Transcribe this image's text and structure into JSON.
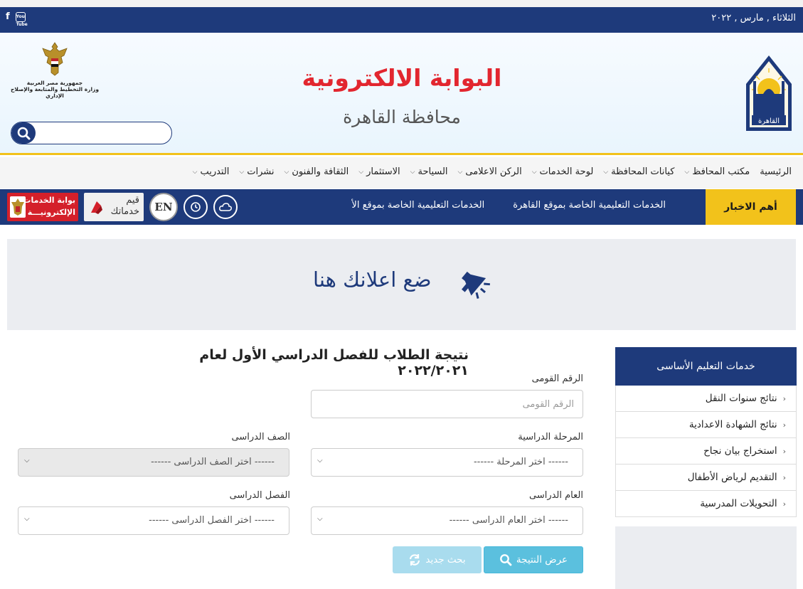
{
  "topbar": {
    "date": "الثلاثاء , مارس , ٢٠٢٢",
    "social": [
      "facebook-icon",
      "youtube-icon"
    ],
    "youtube_label": "You Tube"
  },
  "header": {
    "title": "البوابة الالكترونية",
    "subtitle": "محافظة القاهرة",
    "emblem_line1": "جمهورية مصر العربية",
    "emblem_line2": "وزارة التخطيط والمتابعة والإصلاح الإداري",
    "search_placeholder": ""
  },
  "nav": {
    "items": [
      {
        "label": "الرئيسية",
        "dropdown": false
      },
      {
        "label": "مكتب المحافظ",
        "dropdown": true
      },
      {
        "label": "كيانات المحافظة",
        "dropdown": true
      },
      {
        "label": "لوحة الخدمات",
        "dropdown": true
      },
      {
        "label": "الركن الاعلامى",
        "dropdown": true
      },
      {
        "label": "السياحة",
        "dropdown": true
      },
      {
        "label": "الاستثمار",
        "dropdown": true
      },
      {
        "label": "الثقافة والفنون",
        "dropdown": true
      },
      {
        "label": "نشرات",
        "dropdown": true
      },
      {
        "label": "التدريب",
        "dropdown": true
      }
    ]
  },
  "ticker": {
    "label": "أهم الاخبار",
    "items": [
      "الخدمات التعليمية الخاصة بموقع القاهرة",
      "الخدمات التعليمية الخاصة بموقع الأ"
    ],
    "badge_gov_line1": "بوابة الخدمات",
    "badge_gov_line2": "الإلكترونيـــة",
    "badge_rate_line1": "قيم",
    "badge_rate_line2": "خدماتك",
    "en_label": "EN"
  },
  "ad": {
    "text": "ضع اعلانك هنا"
  },
  "sidebar": {
    "header": "خدمات التعليم الأساسى",
    "items": [
      "نتائج سنوات النقل",
      "نتائج الشهادة الاعدادية",
      "استخراج بيان نجاح",
      "التقديم لرياض الأطفال",
      "التحويلات المدرسية"
    ]
  },
  "form": {
    "title": "نتيجة الطلاب للفصل الدراسي الأول لعام ٢٠٢٢/٢٠٢١",
    "national_id_label": "الرقم القومى",
    "national_id_placeholder": "الرقم القومى",
    "stage_label": "المرحلة الدراسية",
    "stage_value": "------ اختر المرحلة ------",
    "grade_label": "الصف الدراسى",
    "grade_value": "------ اختر الصف الدراسى ------",
    "year_label": "العام الدراسى",
    "year_value": "------ اختر العام الدراسى ------",
    "term_label": "الفصل الدراسى",
    "term_value": "------ اختر الفصل الدراسى ------",
    "show_button": "عرض النتيجة",
    "new_button": "بحث جديد"
  },
  "colors": {
    "navy": "#1e3a7b",
    "accent_yellow": "#f2c21b",
    "title_red": "#e2262f",
    "info_button": "#5bc0de"
  }
}
